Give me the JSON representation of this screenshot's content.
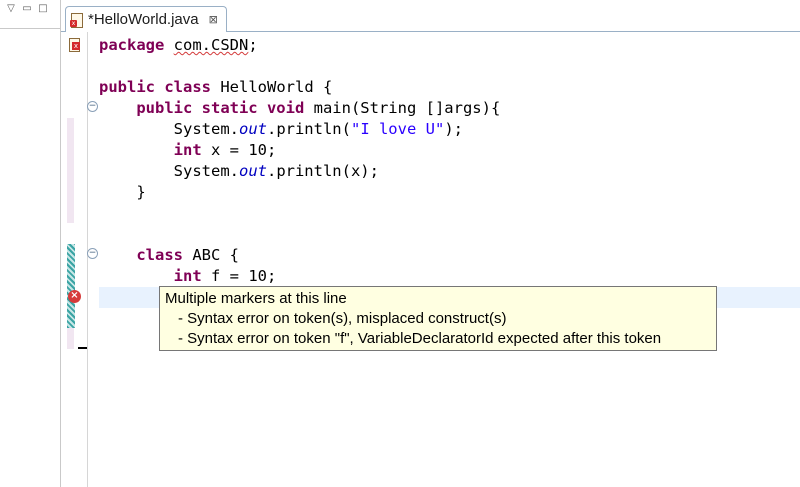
{
  "left_view": {
    "menu_icon": "chevron-down-icon",
    "minimize_icon": "minimize-icon",
    "maximize_icon": "maximize-icon"
  },
  "editor_tab": {
    "label": "*HelloWorld.java",
    "close_glyph": "⊠",
    "icon": "java-file-error-icon"
  },
  "code": {
    "l1_kw": "package",
    "l1_pkg": "com.CSDN",
    "l1_end": ";",
    "l3_kw1": "public",
    "l3_kw2": "class",
    "l3_rest": " HelloWorld {",
    "l4_kw": "public static void",
    "l4_rest": " main(String []args){",
    "l5_a": "System.",
    "l5_field": "out",
    "l5_b": ".println(",
    "l5_str": "\"I love U\"",
    "l5_c": ");",
    "l6_kw": "int",
    "l6_rest": " x = 10;",
    "l7_a": "System.",
    "l7_field": "out",
    "l7_b": ".println(x);",
    "l8": "}",
    "l11_kw": "class",
    "l11_rest": " ABC {",
    "l12_kw": "int",
    "l12_rest": " f = 10;"
  },
  "hover": {
    "title": "Multiple markers at this line",
    "items": [
      "- Syntax error on token(s), misplaced construct(s)",
      "- Syntax error on token \"f\", VariableDeclaratorId expected after this token"
    ]
  },
  "colors": {
    "keyword": "#7f0055",
    "string": "#2a00ff",
    "field": "#0000c0",
    "hover_bg": "#ffffe1",
    "current_line": "#e8f2fe",
    "error": "#d42a2a"
  }
}
